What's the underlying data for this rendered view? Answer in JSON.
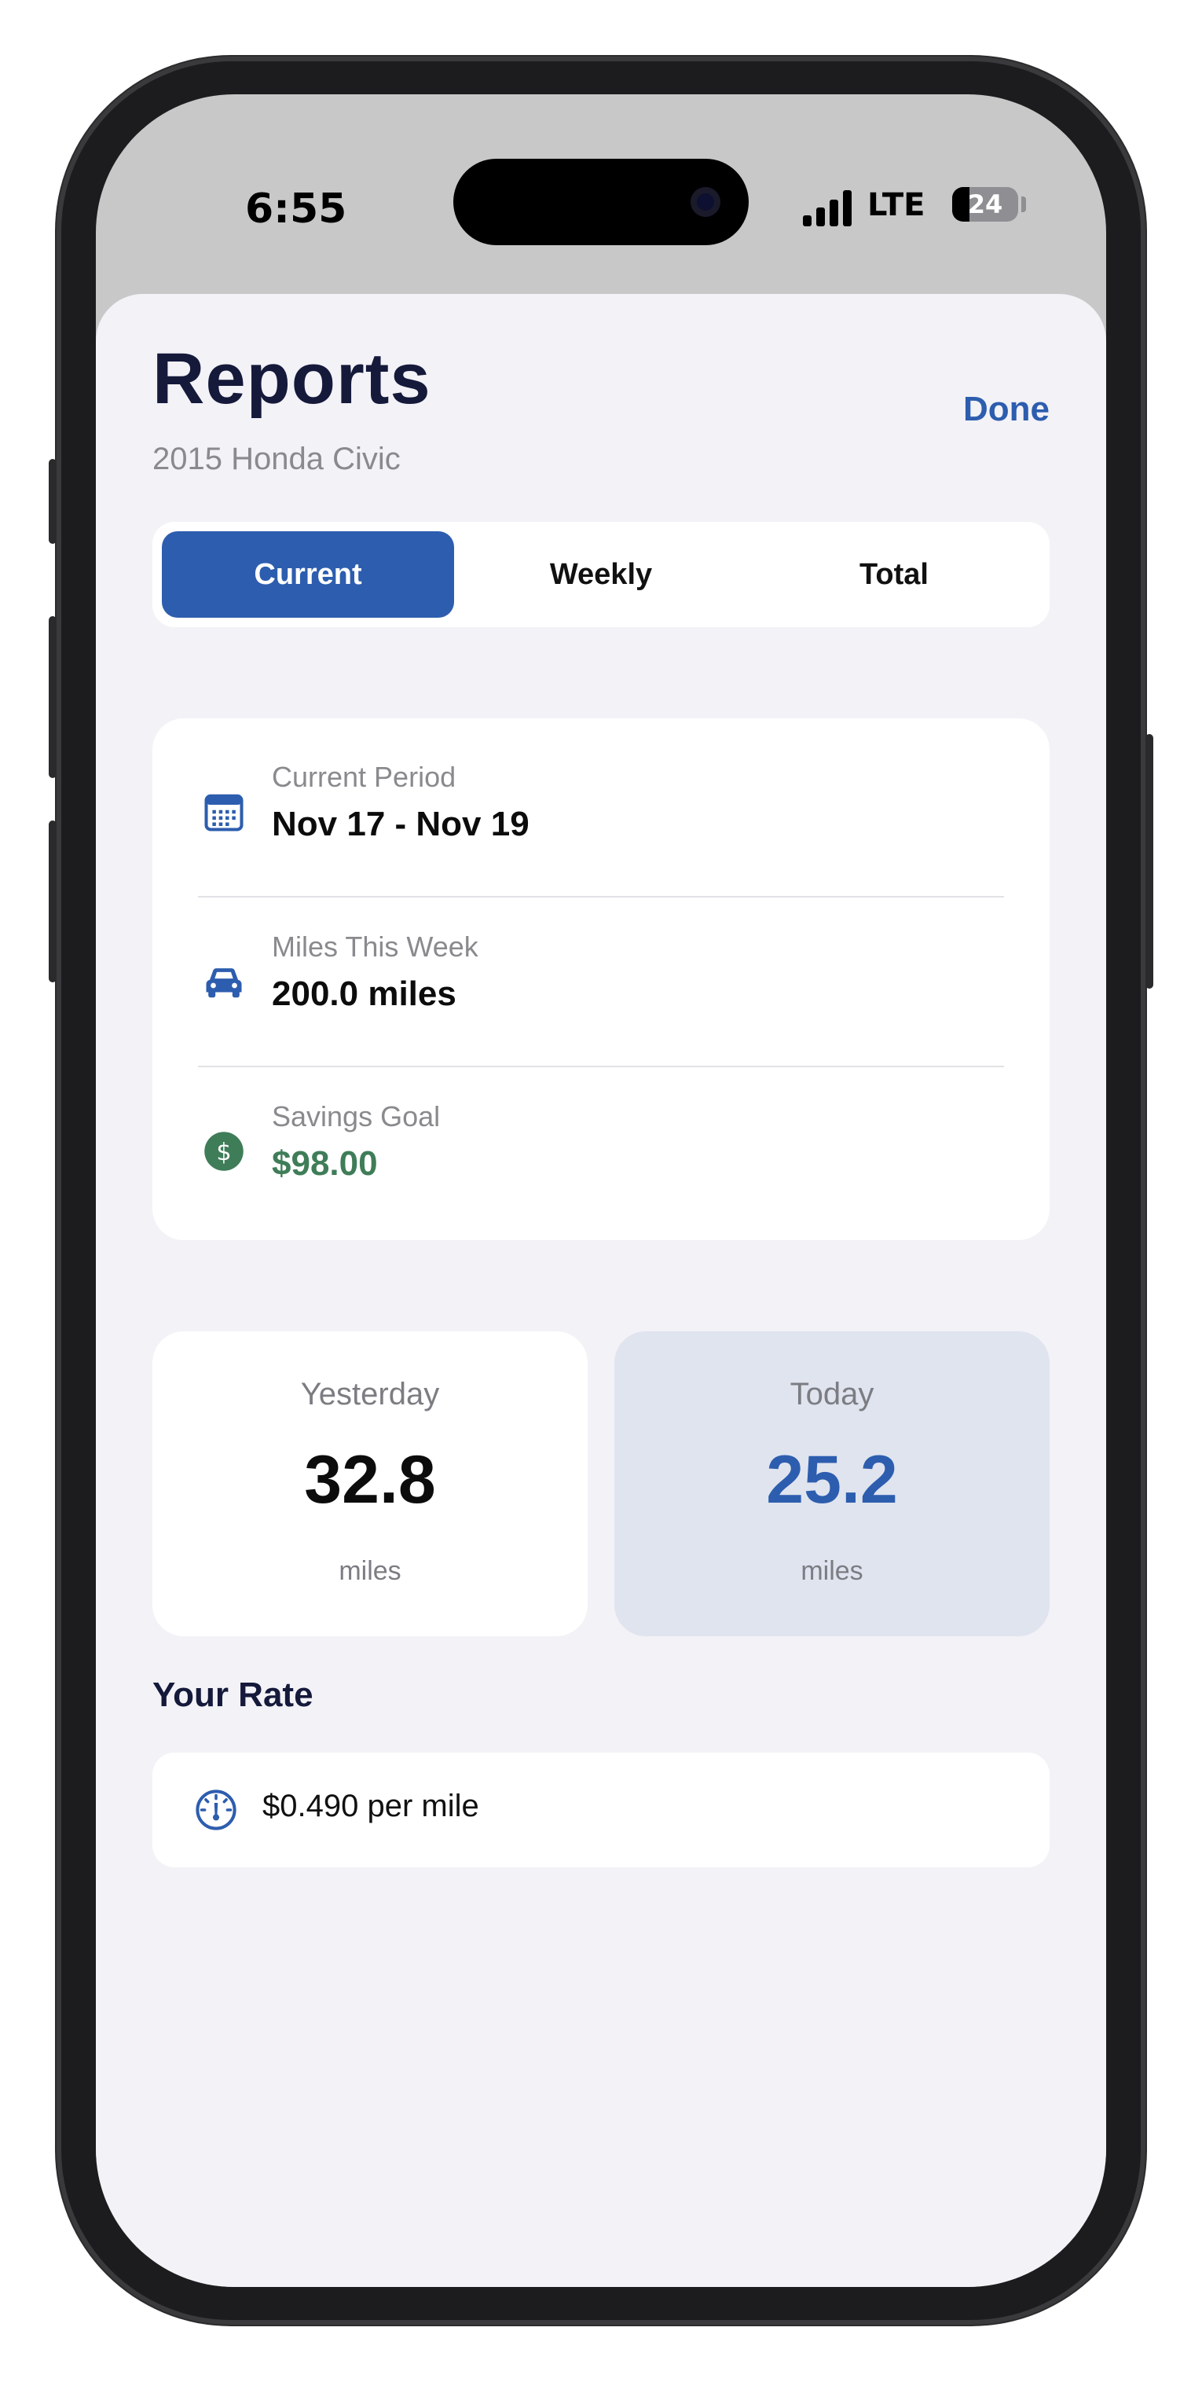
{
  "status_bar": {
    "time": "6:55",
    "network": "LTE",
    "battery": "24"
  },
  "header": {
    "title": "Reports",
    "subtitle": "2015 Honda Civic",
    "done_label": "Done"
  },
  "tabs": [
    {
      "label": "Current",
      "active": true
    },
    {
      "label": "Weekly",
      "active": false
    },
    {
      "label": "Total",
      "active": false
    }
  ],
  "summary": {
    "rows": [
      {
        "icon": "calendar-icon",
        "label": "Current Period",
        "value": "Nov 17 - Nov 19"
      },
      {
        "icon": "car-icon",
        "label": "Miles This Week",
        "value": "200.0 miles"
      },
      {
        "icon": "dollar-icon",
        "label": "Savings Goal",
        "value": "$98.00"
      }
    ]
  },
  "daily": {
    "yesterday": {
      "label": "Yesterday",
      "value": "32.8",
      "unit": "miles"
    },
    "today": {
      "label": "Today",
      "value": "25.2",
      "unit": "miles"
    }
  },
  "rate": {
    "section_title": "Your Rate",
    "icon": "speedometer-icon",
    "text": "$0.490 per mile"
  },
  "colors": {
    "accent": "#2d5dae",
    "savings_green": "#3f7d58",
    "heading": "#15193a",
    "sheet_background": "#f2f2f7"
  }
}
